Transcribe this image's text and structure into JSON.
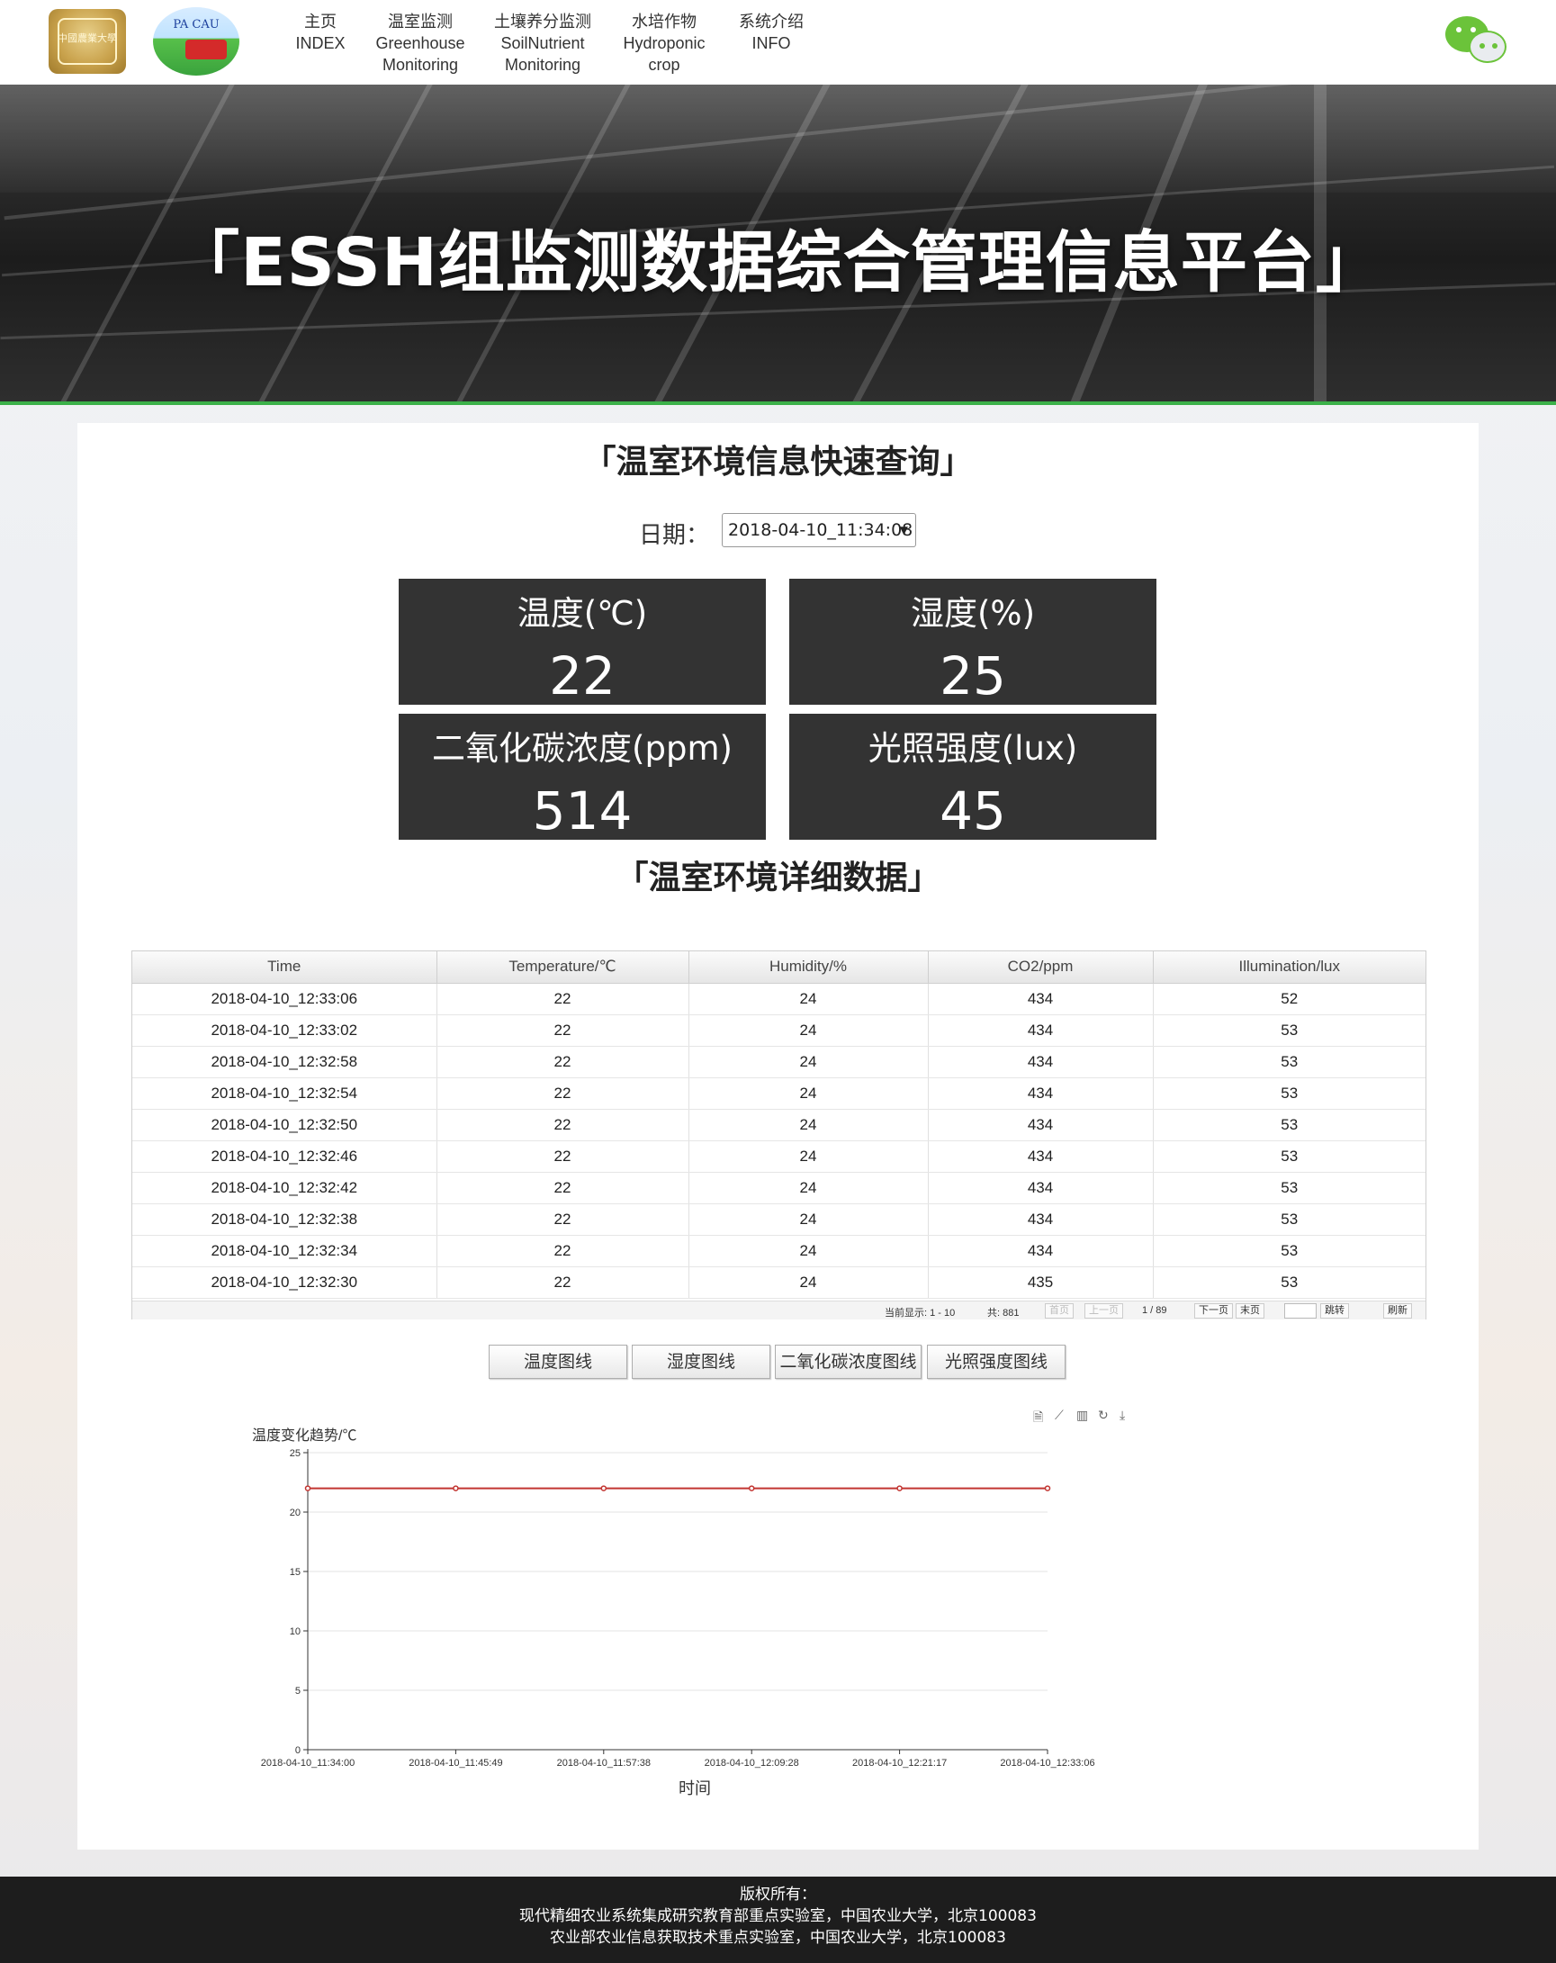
{
  "nav": {
    "logo1_text": "中國農業大學",
    "logo2_text": "PA CAU",
    "items": [
      {
        "cn": "主页",
        "en": "INDEX",
        "en2": ""
      },
      {
        "cn": "温室监测",
        "en": "Greenhouse",
        "en2": "Monitoring"
      },
      {
        "cn": "土壤养分监测",
        "en": "SoilNutrient",
        "en2": "Monitoring"
      },
      {
        "cn": "水培作物",
        "en": "Hydroponic",
        "en2": "crop"
      },
      {
        "cn": "系统介绍",
        "en": "INFO",
        "en2": ""
      }
    ]
  },
  "banner": {
    "title": "「ESSH组监测数据综合管理信息平台」"
  },
  "quick": {
    "title": "「温室环境信息快速查询」",
    "date_label": "日期：",
    "date_value": "2018-04-10_11:34:08",
    "tiles": [
      {
        "label": "温度(℃)",
        "value": "22"
      },
      {
        "label": "湿度(%)",
        "value": "25"
      },
      {
        "label": "二氧化碳浓度(ppm)",
        "value": "514"
      },
      {
        "label": "光照强度(lux)",
        "value": "45"
      }
    ]
  },
  "detail": {
    "title": "「温室环境详细数据」",
    "columns": [
      "Time",
      "Temperature/℃",
      "Humidity/%",
      "CO2/ppm",
      "Illumination/lux"
    ],
    "rows": [
      [
        "2018-04-10_12:33:06",
        "22",
        "24",
        "434",
        "52"
      ],
      [
        "2018-04-10_12:33:02",
        "22",
        "24",
        "434",
        "53"
      ],
      [
        "2018-04-10_12:32:58",
        "22",
        "24",
        "434",
        "53"
      ],
      [
        "2018-04-10_12:32:54",
        "22",
        "24",
        "434",
        "53"
      ],
      [
        "2018-04-10_12:32:50",
        "22",
        "24",
        "434",
        "53"
      ],
      [
        "2018-04-10_12:32:46",
        "22",
        "24",
        "434",
        "53"
      ],
      [
        "2018-04-10_12:32:42",
        "22",
        "24",
        "434",
        "53"
      ],
      [
        "2018-04-10_12:32:38",
        "22",
        "24",
        "434",
        "53"
      ],
      [
        "2018-04-10_12:32:34",
        "22",
        "24",
        "434",
        "53"
      ],
      [
        "2018-04-10_12:32:30",
        "22",
        "24",
        "435",
        "53"
      ]
    ],
    "pager": {
      "showing": "当前显示: 1 - 10",
      "total": "共: 881",
      "first": "首页",
      "prev": "上一页",
      "page": "1 / 89",
      "next": "下一页",
      "last": "末页",
      "jump": "跳转",
      "refresh": "刷新"
    }
  },
  "chart_buttons": [
    "温度图线",
    "湿度图线",
    "二氧化碳浓度图线",
    "光照强度图线"
  ],
  "toolbox_icons": [
    "data-view-icon",
    "line-switch-icon",
    "bar-switch-icon",
    "restore-icon",
    "save-image-icon"
  ],
  "chart_data": {
    "type": "line",
    "title": "",
    "ylabel": "温度变化趋势/℃",
    "xlabel": "时间",
    "x": [
      "2018-04-10_11:34:00",
      "2018-04-10_11:45:49",
      "2018-04-10_11:57:38",
      "2018-04-10_12:09:28",
      "2018-04-10_12:21:17",
      "2018-04-10_12:33:06"
    ],
    "series": [
      {
        "values": [
          22,
          22,
          22,
          22,
          22,
          22
        ],
        "color": "#c23531"
      }
    ],
    "ylim": [
      0,
      25
    ],
    "yticks": [
      0,
      5,
      10,
      15,
      20,
      25
    ],
    "grid": true
  },
  "footer": {
    "line1": "版权所有：",
    "line2": "现代精细农业系统集成研究教育部重点实验室，中国农业大学，北京100083",
    "line3": "农业部农业信息获取技术重点实验室，中国农业大学，北京100083"
  }
}
